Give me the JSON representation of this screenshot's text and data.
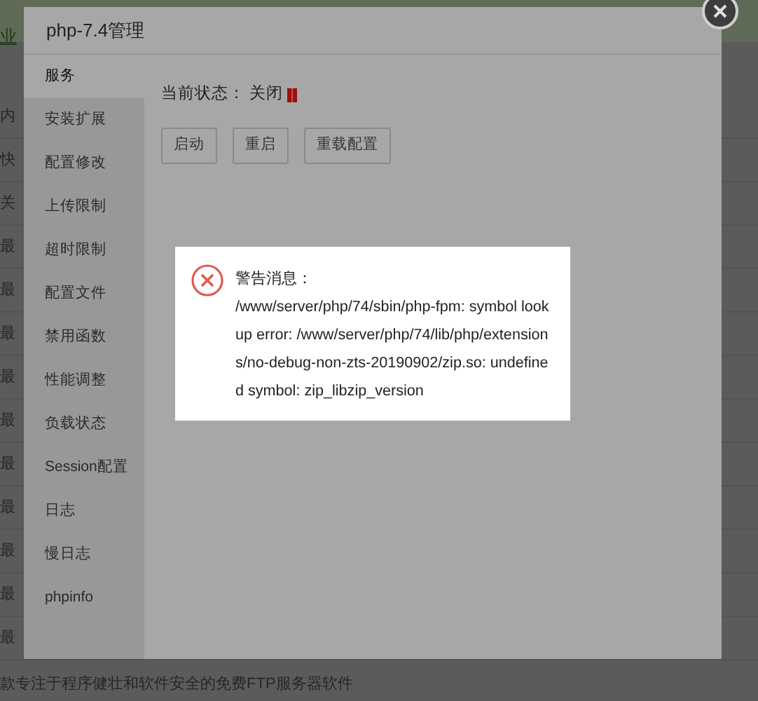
{
  "background": {
    "header_link": "业",
    "row_labels": [
      "内",
      "快",
      "关",
      "最",
      "最",
      "最",
      "最",
      "最",
      "最",
      "最",
      "最",
      "最",
      "最"
    ],
    "footer_text": "款专注于程序健壮和软件安全的免费FTP服务器软件"
  },
  "dialog": {
    "title": "php-7.4管理",
    "menu": [
      {
        "label": "服务",
        "selected": true
      },
      {
        "label": "安装扩展",
        "selected": false
      },
      {
        "label": "配置修改",
        "selected": false
      },
      {
        "label": "上传限制",
        "selected": false
      },
      {
        "label": "超时限制",
        "selected": false
      },
      {
        "label": "配置文件",
        "selected": false
      },
      {
        "label": "禁用函数",
        "selected": false
      },
      {
        "label": "性能调整",
        "selected": false
      },
      {
        "label": "负载状态",
        "selected": false
      },
      {
        "label": "Session配置",
        "selected": false
      },
      {
        "label": "日志",
        "selected": false
      },
      {
        "label": "慢日志",
        "selected": false
      },
      {
        "label": "phpinfo",
        "selected": false
      }
    ],
    "status": {
      "label": "当前状态：",
      "value": "关闭",
      "running": false
    },
    "buttons": [
      "启动",
      "重启",
      "重载配置"
    ]
  },
  "alert": {
    "kind": "error",
    "title": "警告消息：",
    "message": "/www/server/php/74/sbin/php-fpm: symbol lookup error: /www/server/php/74/lib/php/extensions/no-debug-non-zts-20190902/zip.so: undefined symbol: zip_libzip_version"
  }
}
